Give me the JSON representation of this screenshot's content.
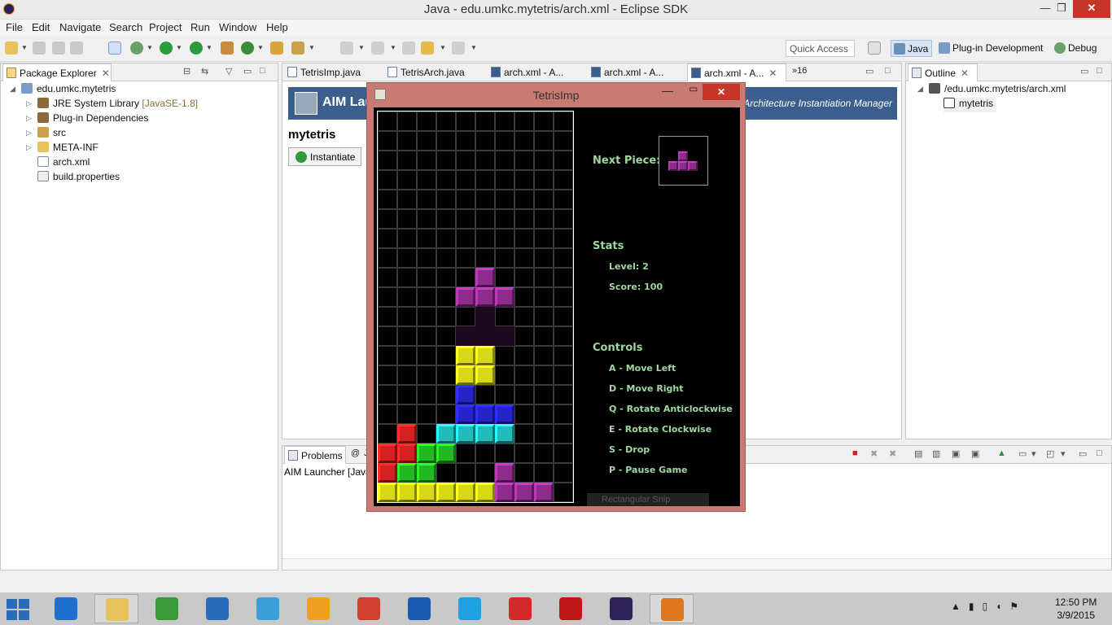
{
  "window": {
    "title": "Java - edu.umkc.mytetris/arch.xml - Eclipse SDK",
    "min": "—",
    "max": "❐",
    "close": "✕"
  },
  "menu": [
    "File",
    "Edit",
    "Navigate",
    "Search",
    "Project",
    "Run",
    "Window",
    "Help"
  ],
  "toolbar": {
    "quick_access_placeholder": "Quick Access",
    "perspectives": {
      "java": "Java",
      "plugin": "Plug-in Development",
      "debug": "Debug"
    }
  },
  "package_explorer": {
    "tab_label": "Package Explorer",
    "project": "edu.umkc.mytetris",
    "items": [
      {
        "label": "JRE System Library",
        "decoration": "[JavaSE-1.8]",
        "icon": "library-icon"
      },
      {
        "label": "Plug-in Dependencies",
        "decoration": "",
        "icon": "library-icon"
      },
      {
        "label": "src",
        "decoration": "",
        "icon": "package-folder-icon"
      },
      {
        "label": "META-INF",
        "decoration": "",
        "icon": "folder-icon"
      },
      {
        "label": "arch.xml",
        "decoration": "",
        "icon": "xml-file-icon"
      },
      {
        "label": "build.properties",
        "decoration": "",
        "icon": "properties-file-icon"
      }
    ]
  },
  "editor": {
    "tabs": [
      "TetrisImp.java",
      "TetrisArch.java",
      "arch.xml - A...",
      "arch.xml - A...",
      "arch.xml - A..."
    ],
    "overflow": "»16",
    "banner_title": "AIM Lau",
    "banner_subtitle": "Architecture Instantiation Manager",
    "heading": "mytetris",
    "instantiate_label": "Instantiate"
  },
  "outline": {
    "tab_label": "Outline",
    "root": "/edu.umkc.mytetris/arch.xml",
    "child": "mytetris"
  },
  "problems": {
    "tab_label": "Problems",
    "second_tab": "@",
    "second_tab_text": "J",
    "row_text": "AIM Launcher [Java"
  },
  "tetris": {
    "title": "TetrisImp",
    "next_label": "Next Piece:",
    "stats_heading": "Stats",
    "level": "Level: 2",
    "score": "Score: 100",
    "controls_heading": "Controls",
    "controls": [
      "A - Move Left",
      "D - Move Right",
      "Q - Rotate Anticlockwise",
      "E - Rotate Clockwise",
      "S - Drop",
      "P - Pause Game"
    ],
    "snip_text": "Rectangular Snip",
    "colors": {
      "purple": "#8e2c8e",
      "yellow": "#d8d81a",
      "blue": "#2424c8",
      "cyan": "#22bcbc",
      "red": "#d42222",
      "green": "#22b822",
      "ghost": "#1e0a1e"
    },
    "board_cols": 10,
    "board_rows": 20,
    "blocks": [
      [
        5,
        8,
        "purple"
      ],
      [
        4,
        9,
        "purple"
      ],
      [
        5,
        9,
        "purple"
      ],
      [
        6,
        9,
        "purple"
      ],
      [
        4,
        11,
        "ghost"
      ],
      [
        5,
        11,
        "ghost"
      ],
      [
        6,
        11,
        "ghost"
      ],
      [
        5,
        10,
        "ghost"
      ],
      [
        4,
        12,
        "yellow"
      ],
      [
        5,
        12,
        "yellow"
      ],
      [
        4,
        13,
        "yellow"
      ],
      [
        5,
        13,
        "yellow"
      ],
      [
        4,
        14,
        "blue"
      ],
      [
        4,
        15,
        "blue"
      ],
      [
        5,
        15,
        "blue"
      ],
      [
        6,
        15,
        "blue"
      ],
      [
        3,
        16,
        "cyan"
      ],
      [
        4,
        16,
        "cyan"
      ],
      [
        5,
        16,
        "cyan"
      ],
      [
        6,
        16,
        "cyan"
      ],
      [
        1,
        16,
        "red"
      ],
      [
        0,
        17,
        "red"
      ],
      [
        1,
        17,
        "red"
      ],
      [
        0,
        18,
        "red"
      ],
      [
        2,
        17,
        "green"
      ],
      [
        3,
        17,
        "green"
      ],
      [
        1,
        18,
        "green"
      ],
      [
        2,
        18,
        "green"
      ],
      [
        6,
        18,
        "purple"
      ],
      [
        0,
        19,
        "yellow"
      ],
      [
        1,
        19,
        "yellow"
      ],
      [
        2,
        19,
        "yellow"
      ],
      [
        3,
        19,
        "yellow"
      ],
      [
        4,
        19,
        "yellow"
      ],
      [
        5,
        19,
        "yellow"
      ],
      [
        6,
        19,
        "purple"
      ],
      [
        7,
        19,
        "purple"
      ],
      [
        8,
        19,
        "purple"
      ]
    ],
    "next_blocks": [
      [
        1,
        0,
        "purple"
      ],
      [
        0,
        1,
        "purple"
      ],
      [
        1,
        1,
        "purple"
      ],
      [
        2,
        1,
        "purple"
      ]
    ]
  },
  "taskbar": {
    "apps": [
      "ie-icon",
      "explorer-icon",
      "store-icon",
      "home-icon",
      "mail-icon",
      "headphones-icon",
      "chrome-icon",
      "lenovo-icon",
      "skype-icon",
      "gmail-icon",
      "acrobat-icon",
      "eclipse-icon",
      "java-icon"
    ],
    "time": "12:50 PM",
    "date": "3/9/2015"
  }
}
